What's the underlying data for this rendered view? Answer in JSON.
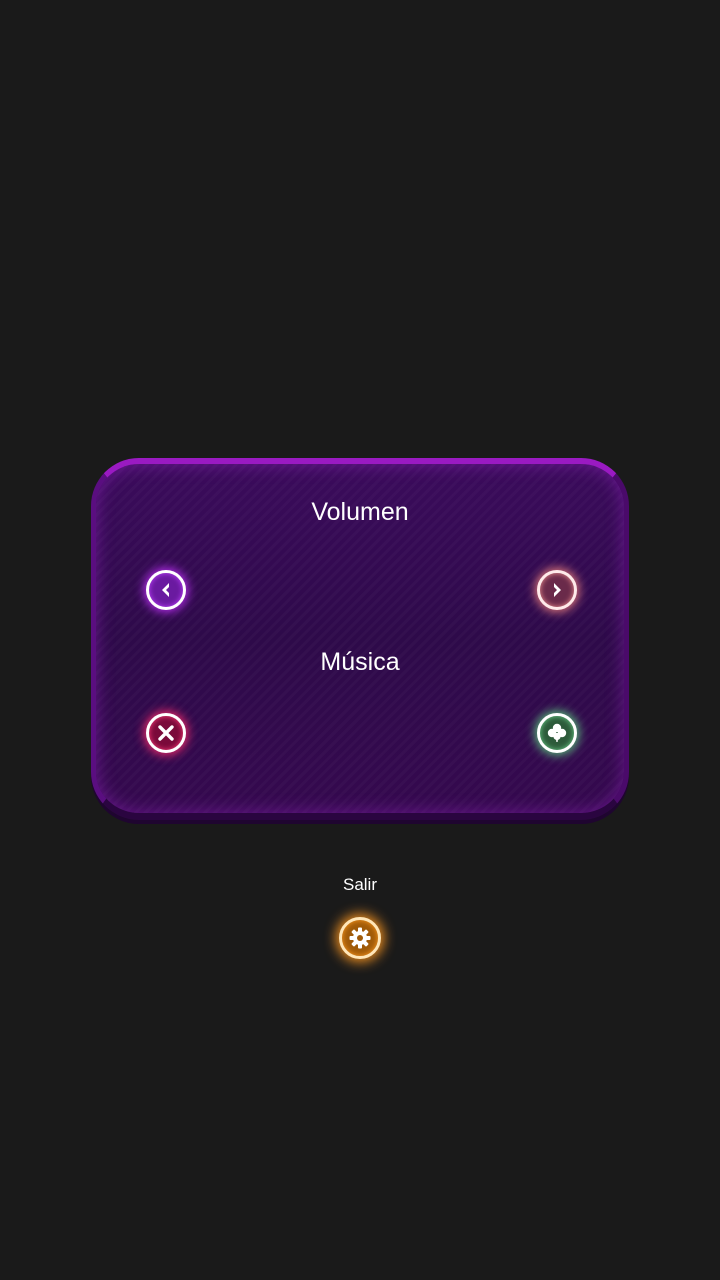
{
  "panel": {
    "volume_label": "Volumen",
    "music_label": "Música",
    "volume_left_icon": "chevron-left-icon",
    "volume_right_icon": "chevron-right-icon",
    "music_off_icon": "close-icon",
    "music_on_icon": "clover-icon"
  },
  "footer": {
    "exit_label": "Salir",
    "exit_icon": "gear-icon"
  },
  "colors": {
    "background": "#1a1a1a",
    "panel": "#2e0a4a",
    "panel_border": "#9a1ac2",
    "purple_glow": "#b82ef0",
    "pink_glow": "#e07a7a",
    "red_glow": "#f02a6a",
    "green_glow": "#5ac07a",
    "orange_glow": "#f09020"
  }
}
